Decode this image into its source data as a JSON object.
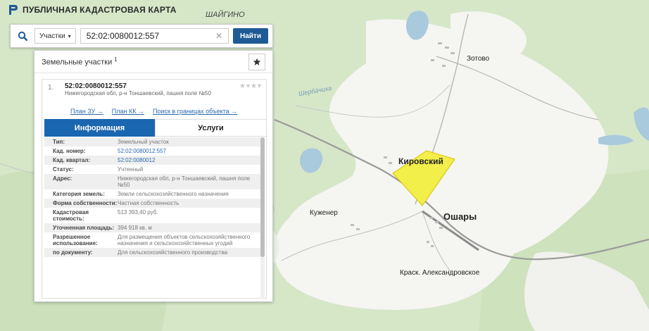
{
  "app": {
    "title": "ПУБЛИЧНАЯ КАДАСТРОВАЯ КАРТА"
  },
  "search": {
    "type_label": "Участки",
    "query": "52:02:0080012:557",
    "button": "Найти"
  },
  "panel": {
    "title": "Земельные участки",
    "count": "1",
    "result": {
      "index": "1.",
      "cadastral_number": "52:02:0080012:557",
      "address": "Нижегородская обл, р-н Тоншаевский, пашня поле №50",
      "links": [
        "План ЗУ →",
        "План КК →",
        "Поиск в границах объекта →"
      ]
    },
    "tabs": [
      "Информация",
      "Услуги"
    ],
    "info_rows": [
      {
        "key": "Тип:",
        "value": "Земельный участок"
      },
      {
        "key": "Кад. номер:",
        "value": "52:02:0080012:557",
        "link": true
      },
      {
        "key": "Кад. квартал:",
        "value": "52:02:0080012",
        "link": true
      },
      {
        "key": "Статус:",
        "value": "Учтенный"
      },
      {
        "key": "Адрес:",
        "value": "Нижегородская обл, р-н Тоншаевский, пашня поле №50"
      },
      {
        "key": "Категория земель:",
        "value": "Земли сельскохозяйственного назначения"
      },
      {
        "key": "Форма собственности:",
        "value": "Частная собственность"
      },
      {
        "key": "Кадастровая стоимость:",
        "value": "513 393,40 руб."
      },
      {
        "key": "Уточненная площадь:",
        "value": "394 918 кв. м"
      },
      {
        "key": "Разрешенное использование:",
        "value": "Для размещения объектов сельскохозяйственного назначения и сельскохозяйственных угодий"
      },
      {
        "key": "по документу:",
        "value": "Для сельскохозяйственного производства"
      }
    ]
  },
  "map": {
    "labels": {
      "shaigino": "ШАЙГИНО",
      "zotovo": "Зотово",
      "river": "Шерба́чиха",
      "kirovsky": "Кировский",
      "oshary": "Ошары",
      "kuzhener": "Кужeнер",
      "krasn": "Краск. Александровское"
    },
    "colors": {
      "parcel": "#f2ee4a",
      "forest": "#cfe3bf",
      "field": "#f6f6f3",
      "water": "#a9c9dd",
      "road": "#8e8e8e"
    }
  }
}
